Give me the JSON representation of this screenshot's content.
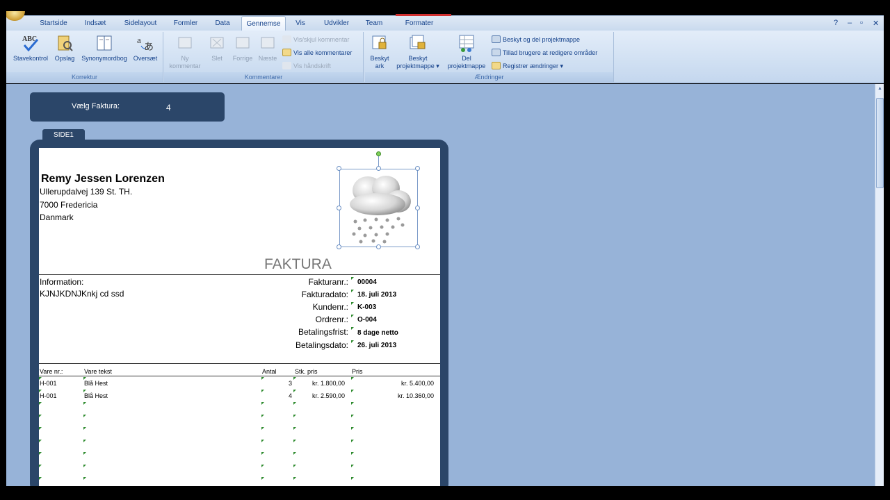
{
  "tabs": [
    "Startside",
    "Indsæt",
    "Sidelayout",
    "Formler",
    "Data",
    "Gennemse",
    "Vis",
    "Udvikler",
    "Team",
    "Formater"
  ],
  "active_tab": "Gennemse",
  "ribbon": {
    "korrektur": {
      "label": "Korrektur",
      "buttons": [
        "Stavekontrol",
        "Opslag",
        "Synonymordbog",
        "Oversæt"
      ]
    },
    "kommentarer": {
      "label": "Kommentarer",
      "ny_line1": "Ny",
      "ny_line2": "kommentar",
      "slet": "Slet",
      "forrige": "Forrige",
      "naeste": "Næste",
      "vis_skjul": "Vis/skjul kommentar",
      "vis_alle": "Vis alle kommentarer",
      "vis_haandskrift": "Vis håndskrift"
    },
    "aendringer": {
      "label": "Ændringer",
      "beskyt_ark_1": "Beskyt",
      "beskyt_ark_2": "ark",
      "beskyt_pm_1": "Beskyt",
      "beskyt_pm_2": "projektmappe",
      "del_pm_1": "Del",
      "del_pm_2": "projektmappe",
      "beskyt_del": "Beskyt og del projektmappe",
      "tillad": "Tillad brugere at redigere områder",
      "registrer": "Registrer ændringer"
    }
  },
  "selector": {
    "label": "Vælg Faktura:",
    "value": "4"
  },
  "side_tab": "SIDE1",
  "invoice": {
    "name": "Remy Jessen Lorenzen",
    "address": [
      "Ullerupdalvej 139 St. TH.",
      "7000 Fredericia",
      "Danmark"
    ],
    "title": "FAKTURA",
    "info_label": "Information:",
    "info_value": "KJNJKDNJKnkj cd ssd",
    "fields": [
      {
        "label": "Fakturanr.:",
        "value": "00004"
      },
      {
        "label": "Fakturadato:",
        "value": "18. juli 2013"
      },
      {
        "label": "Kundenr.:",
        "value": "K-003"
      },
      {
        "label": "Ordrenr.:",
        "value": "O-004"
      },
      {
        "label": "Betalingsfrist:",
        "value": "8 dage netto"
      },
      {
        "label": "Betalingsdato:",
        "value": "26. juli 2013"
      }
    ],
    "columns": [
      "Vare nr.:",
      "Vare tekst",
      "Antal",
      "Stk. pris",
      "Pris"
    ],
    "rows": [
      {
        "varenr": "H-001",
        "tekst": "Blå Hest",
        "antal": "3",
        "stkpris": "kr. 1.800,00",
        "pris": "kr. 5.400,00"
      },
      {
        "varenr": "H-001",
        "tekst": "Blå Hest",
        "antal": "4",
        "stkpris": "kr. 2.590,00",
        "pris": "kr. 10.360,00"
      }
    ]
  },
  "icons": {
    "stavekontrol": "abc-check-icon",
    "opslag": "research-book-icon",
    "synonymordbog": "thesaurus-icon",
    "oversaet": "translate-icon",
    "picture": "weather-cloud-rain-picture"
  },
  "colors": {
    "frame": "#2b4669",
    "workspace": "#97b3d8",
    "ribbon": "#c4d7ee",
    "tab_text": "#15428b"
  }
}
